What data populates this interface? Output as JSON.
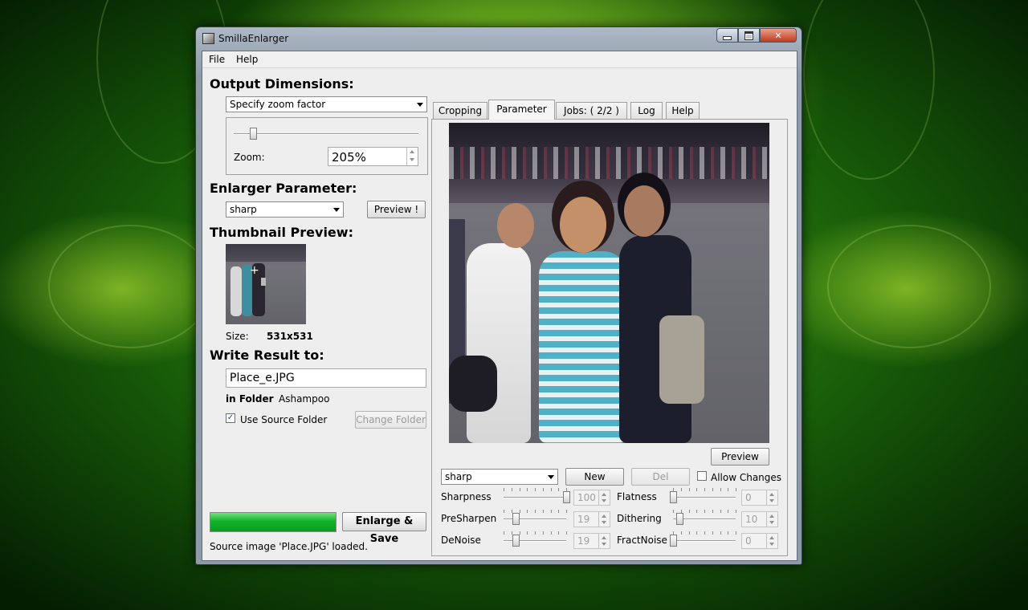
{
  "window": {
    "title": "SmillaEnlarger"
  },
  "menu": [
    "File",
    "Help"
  ],
  "left": {
    "output_heading": "Output Dimensions:",
    "dimension_mode": "Specify zoom factor",
    "zoom_label": "Zoom:",
    "zoom_value": "205%",
    "zoom_slider_fraction": 0.1,
    "enlarger_heading": "Enlarger Parameter:",
    "preset": "sharp",
    "preview_button": "Preview !",
    "thumbnail_heading": "Thumbnail Preview:",
    "size_label": "Size:",
    "size_value": "531x531",
    "write_heading": "Write Result to:",
    "filename": "Place_e.JPG",
    "in_folder_label": "in Folder",
    "folder_name": "Ashampoo",
    "use_source_folder_label": "Use Source Folder",
    "use_source_folder_checked": true,
    "change_folder_button": "Change Folder",
    "progress_percent": 100,
    "enlarge_button": "Enlarge & Save"
  },
  "tabs": [
    {
      "label": "Cropping",
      "active": false
    },
    {
      "label": "Parameter",
      "active": true
    },
    {
      "label": "Jobs: ( 2/2 )",
      "active": false
    },
    {
      "label": "Log",
      "active": false
    },
    {
      "label": "Help",
      "active": false
    }
  ],
  "parameter": {
    "preview_button": "Preview",
    "preset": "sharp",
    "new_button": "New",
    "del_button": "Del",
    "allow_changes_label": "Allow Changes",
    "allow_changes_checked": false,
    "sliders": [
      {
        "label": "Sharpness",
        "value": "100",
        "fraction": 1.0
      },
      {
        "label": "PreSharpen",
        "value": "19",
        "fraction": 0.19
      },
      {
        "label": "DeNoise",
        "value": "19",
        "fraction": 0.19
      },
      {
        "label": "Flatness",
        "value": "0",
        "fraction": 0.0
      },
      {
        "label": "Dithering",
        "value": "10",
        "fraction": 0.1
      },
      {
        "label": "FractNoise",
        "value": "0",
        "fraction": 0.0
      }
    ]
  },
  "status": "Source image 'Place.JPG' loaded.",
  "colors": {
    "progress": "#12b52a",
    "desktop": "#3c9a14"
  }
}
